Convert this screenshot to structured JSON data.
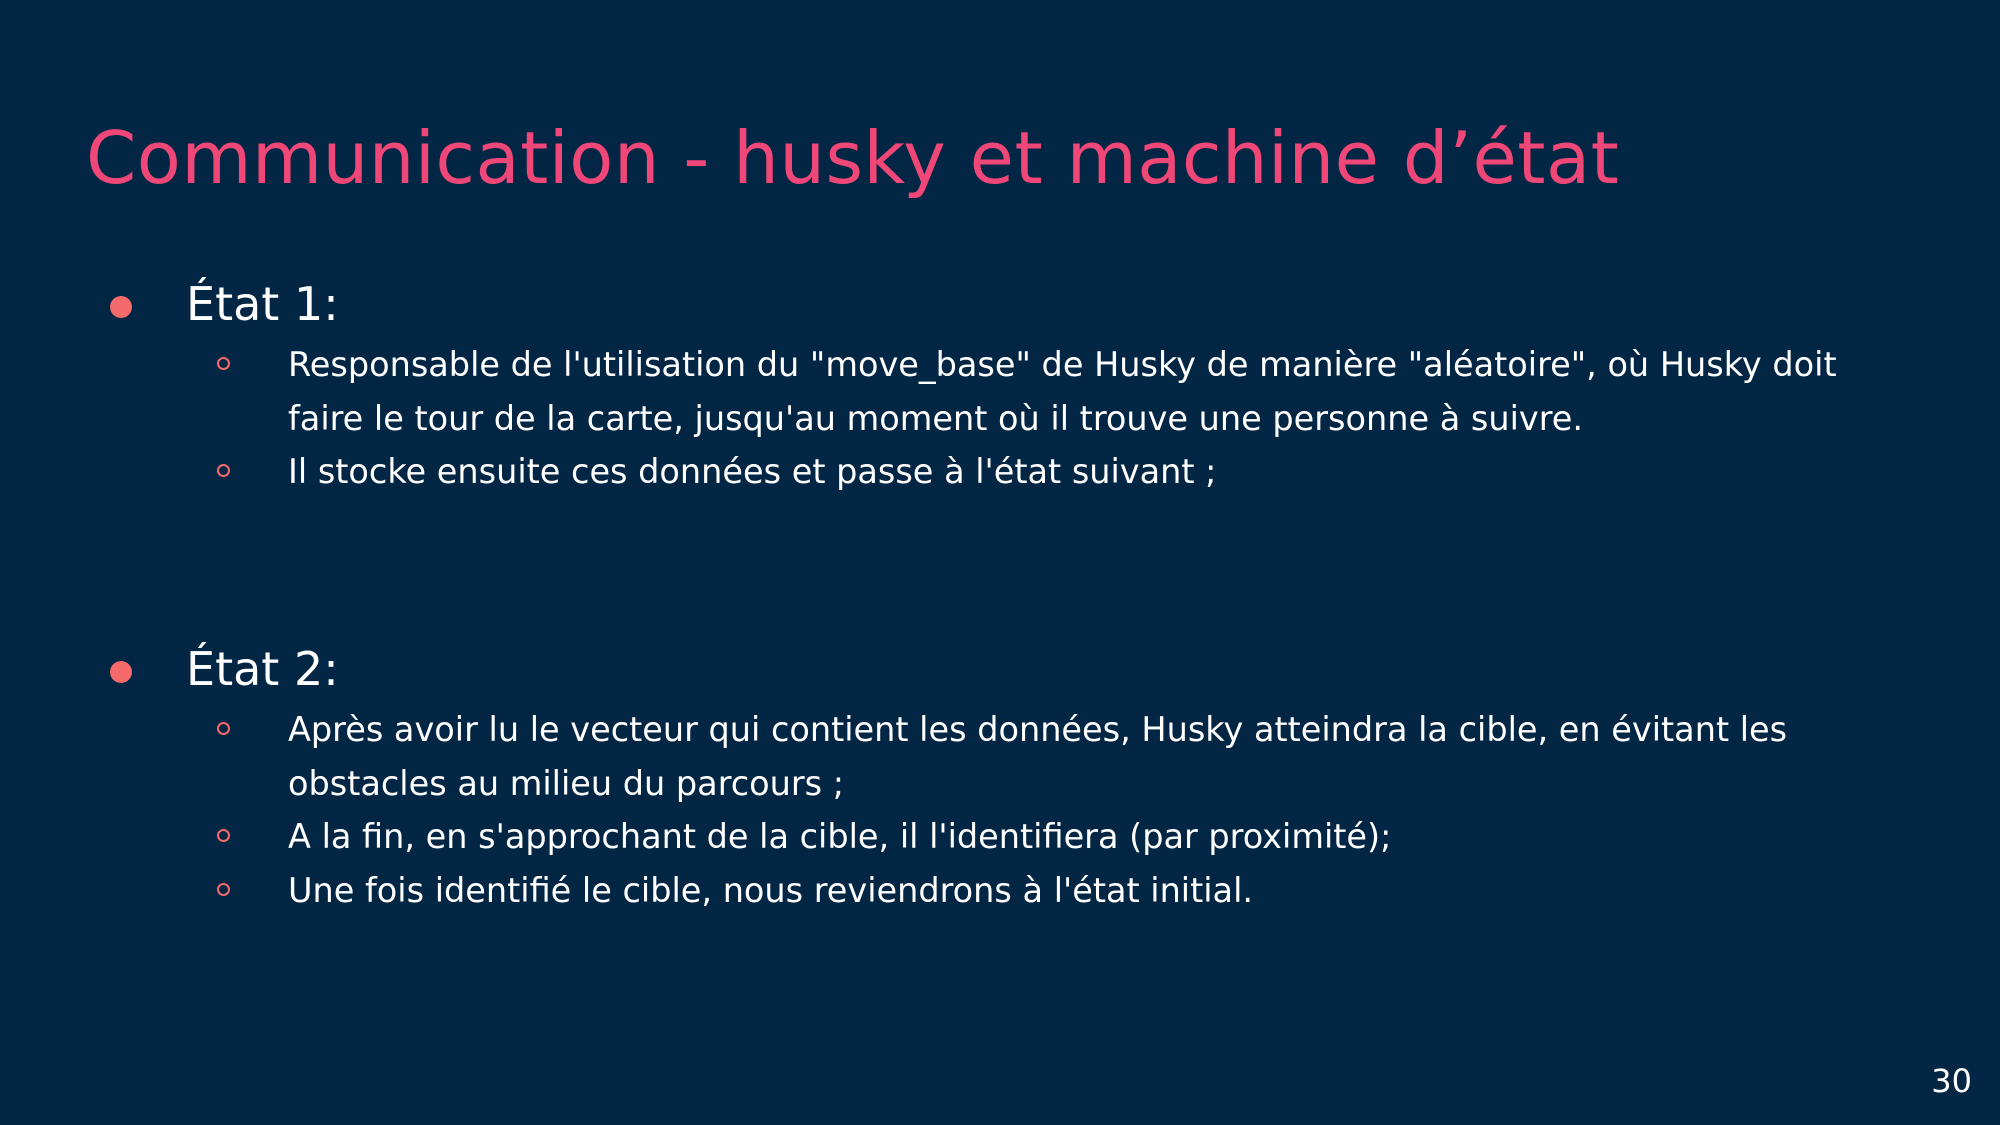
{
  "slide": {
    "title": "Communication - husky et machine d’état",
    "page_number": "30",
    "colors": {
      "background": "#022644",
      "title": "#ef4778",
      "bullet": "#f56a6a",
      "text": "#ffffff"
    },
    "sections": [
      {
        "heading": "État 1:",
        "items": [
          "Responsable de l'utilisation du \"move_base\" de Husky de manière \"aléatoire\", où Husky doit faire le tour de la carte, jusqu'au moment où il trouve une personne à suivre.",
          "Il stocke ensuite ces données et passe à l'état suivant ;"
        ]
      },
      {
        "heading": "État 2:",
        "items": [
          "Après avoir lu le vecteur qui contient les données, Husky atteindra la cible, en évitant les obstacles au milieu du parcours ;",
          "A la fin, en s'approchant de la cible, il l'identifiera (par proximité);",
          "Une fois identifié le cible, nous reviendrons à l'état initial."
        ]
      }
    ]
  }
}
